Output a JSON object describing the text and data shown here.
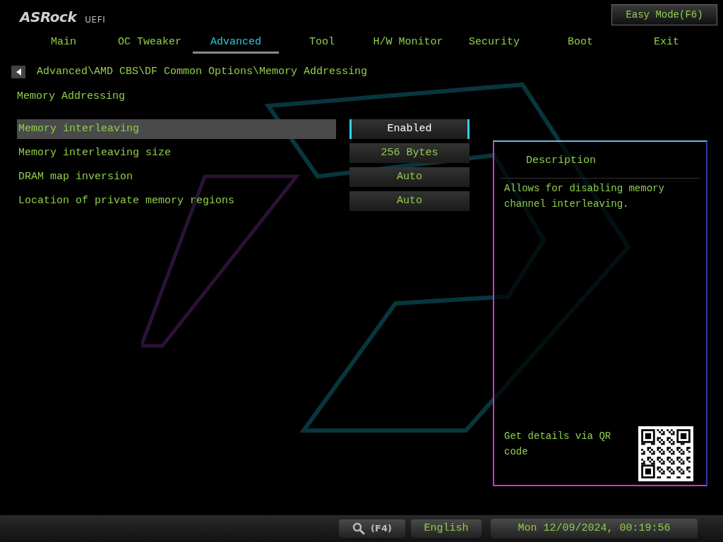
{
  "logo": {
    "brand": "ASRock",
    "suffix": "UEFI"
  },
  "easy_mode_button": "Easy Mode(F6)",
  "tabs": [
    {
      "label": "Main",
      "selected": false
    },
    {
      "label": "OC Tweaker",
      "selected": false
    },
    {
      "label": "Advanced",
      "selected": true
    },
    {
      "label": "Tool",
      "selected": false
    },
    {
      "label": "H/W Monitor",
      "selected": false
    },
    {
      "label": "Security",
      "selected": false
    },
    {
      "label": "Boot",
      "selected": false
    },
    {
      "label": "Exit",
      "selected": false
    }
  ],
  "breadcrumb": "Advanced\\AMD CBS\\DF Common Options\\Memory Addressing",
  "section_title": "Memory Addressing",
  "settings": [
    {
      "label": "Memory interleaving",
      "value": "Enabled",
      "selected": true
    },
    {
      "label": "Memory interleaving size",
      "value": "256 Bytes",
      "selected": false
    },
    {
      "label": "DRAM map inversion",
      "value": "Auto",
      "selected": false
    },
    {
      "label": "Location of private memory regions",
      "value": "Auto",
      "selected": false
    }
  ],
  "description": {
    "title": "Description",
    "text": "Allows for disabling memory channel interleaving.",
    "qr_caption": "Get details via QR code"
  },
  "status_bar": {
    "search_key": "(F4)",
    "language": "English",
    "datetime": "Mon 12/09/2024, 00:19:56"
  }
}
